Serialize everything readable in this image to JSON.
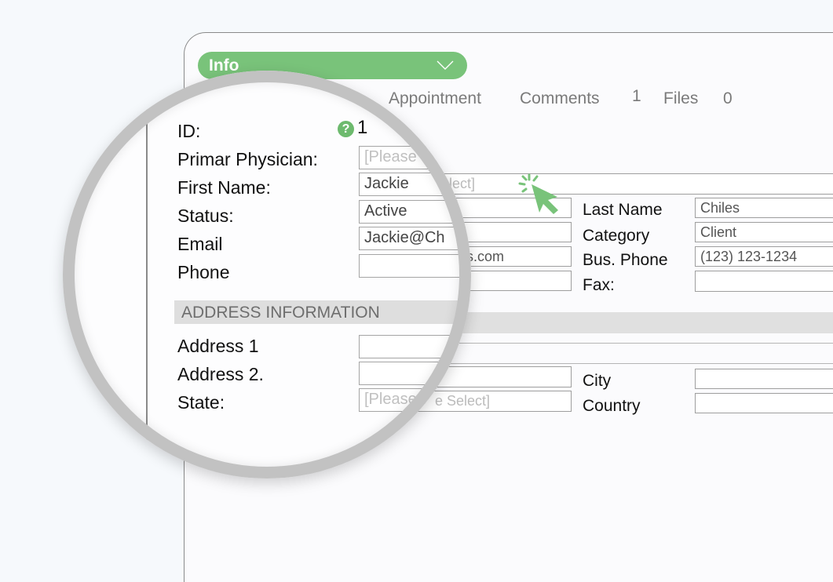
{
  "header": {
    "section_dropdown": "Info",
    "tabs": [
      {
        "label": "Appointment",
        "count": null
      },
      {
        "label": "Comments",
        "count": "1"
      },
      {
        "label": "Files",
        "count": "0"
      }
    ]
  },
  "form": {
    "id_label": "ID:",
    "id_value": "1",
    "primary_physician_label": "Primar Physician:",
    "primary_physician_placeholder": "[Please Select]",
    "first_name_label": "First Name:",
    "first_name_value": "Jackie",
    "status_label": "Status:",
    "status_value": "Active",
    "email_label": "Email",
    "email_value": "Jackie@Chiles.com",
    "email_visible_zoomed": "Jackie@Ch",
    "email_visible_tail": "es.com",
    "phone_label": "Phone",
    "phone_value": "",
    "last_name_label": "Last Name",
    "last_name_value": "Chiles",
    "category_label": "Category",
    "category_value": "Client",
    "bus_phone_label": "Bus. Phone",
    "bus_phone_value": "(123) 123-1234",
    "fax_label": "Fax:",
    "fax_value": "",
    "physician_select_tail": "elect]"
  },
  "address": {
    "section_title": "ADDRESS INFORMATION",
    "address1_label": "Address 1",
    "address1_value": "",
    "address2_label": "Address 2.",
    "address2_value": "",
    "state_label": "State:",
    "state_placeholder": "[Please Select]",
    "state_placeholder_tail": "e Select]",
    "city_label": "City",
    "city_value": "",
    "country_label": "Country",
    "country_value": ""
  },
  "colors": {
    "accent_green": "#79c37a",
    "ring_gray": "#c2c2c2"
  },
  "icons": {
    "help": "?",
    "dropdown": "chevron-down-icon",
    "cursor": "click-cursor-icon"
  }
}
